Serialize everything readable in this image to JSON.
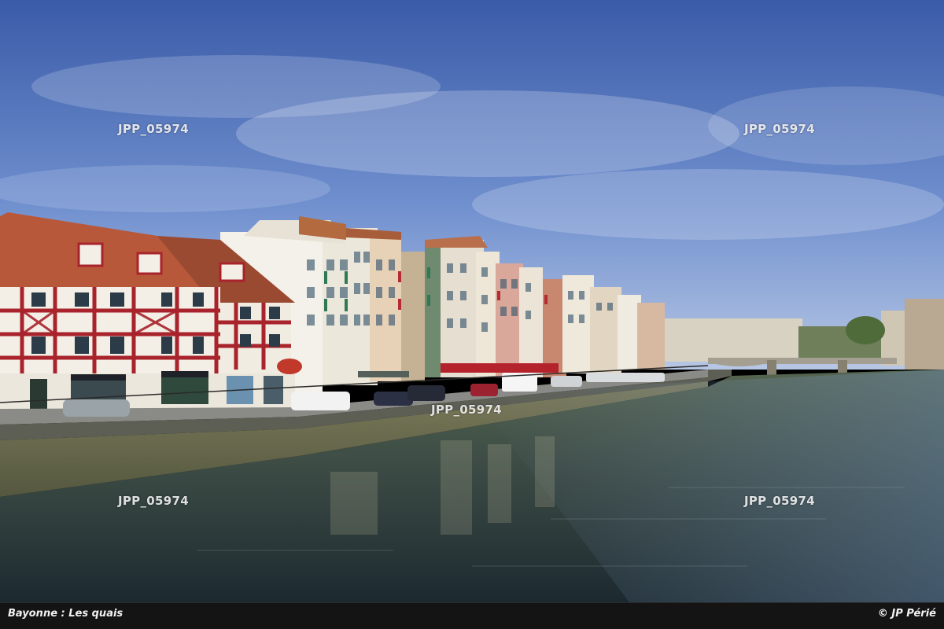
{
  "photo": {
    "subject": "riverside-quay-with-half-timbered-houses",
    "colors": {
      "sky_top": "#3f63b0",
      "sky_bottom": "#a9bde0",
      "water_top": "#4a5a4c",
      "water_bottom": "#1f2e34",
      "roof": "#b8583a",
      "timber": "#a8232b",
      "wall": "#f3efe6",
      "quay": "#8b8a6a"
    }
  },
  "watermarks": {
    "top_left": "JPP_05974",
    "top_right": "JPP_05974",
    "center": "JPP_05974",
    "bottom_left": "JPP_05974",
    "bottom_right": "JPP_05974"
  },
  "caption": {
    "title": "Bayonne : Les quais",
    "copyright": "© JP Périé"
  }
}
